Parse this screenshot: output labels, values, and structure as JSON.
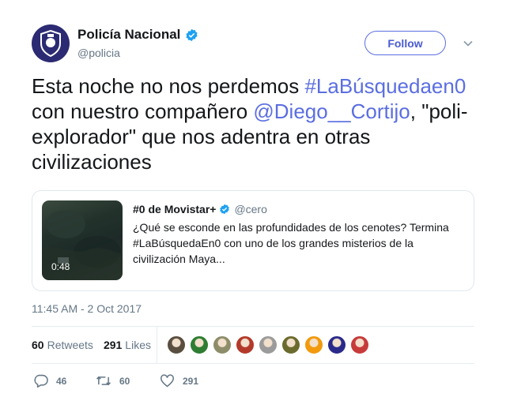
{
  "author": {
    "name": "Policía Nacional",
    "handle": "@policia",
    "avatar_icon": "police-badge-icon"
  },
  "follow_button": {
    "label": "Follow"
  },
  "tweet": {
    "text_part1": "Esta noche no nos perdemos ",
    "hashtag": "#LaBúsquedaen0",
    "text_part2": " con nuestro compañero ",
    "mention": "@Diego__Cortijo",
    "text_part3": ", \"poli-explorador\" que nos adentra en otras civilizaciones"
  },
  "card": {
    "duration": "0:48",
    "account_name": "#0 de Movistar+",
    "account_handle": "@cero",
    "body": "¿Qué se esconde en las profundidades de los cenotes? Termina #LaBúsquedaEn0 con uno de los grandes misterios de la civilización Maya..."
  },
  "timestamp": "11:45 AM - 2 Oct 2017",
  "stats": {
    "retweets_count": "60",
    "retweets_label": "Retweets",
    "likes_count": "291",
    "likes_label": "Likes"
  },
  "liker_faces": [
    {
      "color": "#5a4e3f"
    },
    {
      "color": "#2e7d32"
    },
    {
      "color": "#8d8d6a"
    },
    {
      "color": "#b33a2a"
    },
    {
      "color": "#9b9b9b"
    },
    {
      "color": "#6b6b2e"
    },
    {
      "color": "#f29a0c"
    },
    {
      "color": "#2a2a8a"
    },
    {
      "color": "#c73b3b"
    }
  ],
  "actions": {
    "reply_count": "46",
    "retweet_count": "60",
    "like_count": "291"
  },
  "colors": {
    "link": "#5b6ee1",
    "verified": "#1da1f2",
    "muted": "#657786"
  }
}
